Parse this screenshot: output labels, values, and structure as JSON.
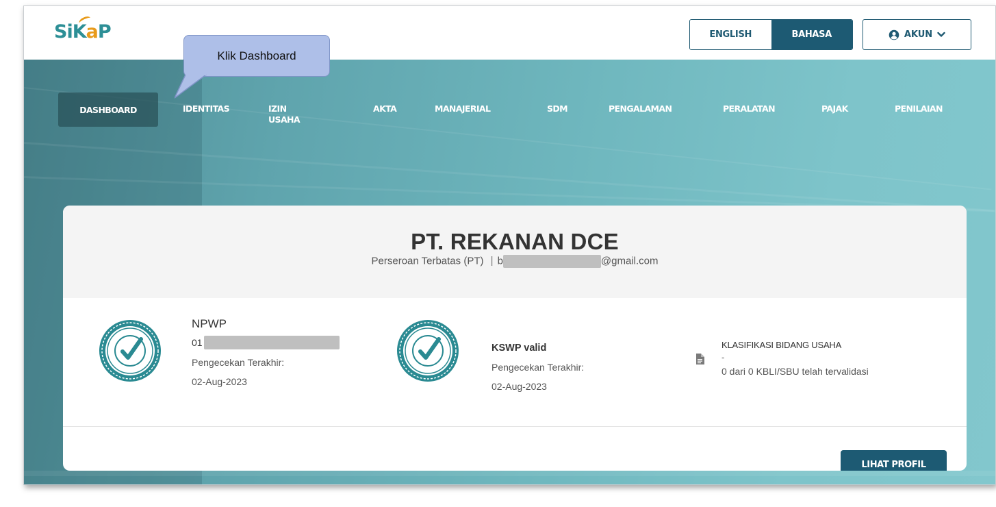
{
  "header": {
    "logo": {
      "s": "S",
      "i": "i",
      "k": "K",
      "a": "a",
      "p": "P"
    },
    "lang_english": "ENGLISH",
    "lang_bahasa": "BAHASA",
    "akun_label": "AKUN"
  },
  "nav": {
    "items": [
      {
        "label": "DASHBOARD"
      },
      {
        "label": "IDENTITAS"
      },
      {
        "label": "IZIN\nUSAHA"
      },
      {
        "label": "AKTA"
      },
      {
        "label": "MANAJERIAL"
      },
      {
        "label": "SDM"
      },
      {
        "label": "PENGALAMAN"
      },
      {
        "label": "PERALATAN"
      },
      {
        "label": "PAJAK"
      },
      {
        "label": "PENILAIAN"
      }
    ]
  },
  "callout": {
    "text": "Klik Dashboard"
  },
  "company": {
    "name": "PT. REKANAN DCE",
    "type": "Perseroan Terbatas (PT)",
    "separator": "|",
    "email_prefix": "b",
    "email_suffix": "@gmail.com"
  },
  "npwp": {
    "title": "NPWP",
    "number_prefix": "01",
    "check_label": "Pengecekan Terakhir:",
    "check_date": "02-Aug-2023"
  },
  "kswp": {
    "title": "KSWP valid",
    "check_label": "Pengecekan Terakhir:",
    "check_date": "02-Aug-2023"
  },
  "klasifikasi": {
    "title": "KLASIFIKASI BIDANG USAHA",
    "value": "-",
    "status": "0 dari 0 KBLI/SBU telah tervalidasi"
  },
  "actions": {
    "lihat_profil": "LIHAT PROFIL"
  },
  "colors": {
    "primary": "#1d5a73",
    "teal": "#2d8f96",
    "accent": "#e89b1c",
    "badge": "#2a8a92"
  }
}
